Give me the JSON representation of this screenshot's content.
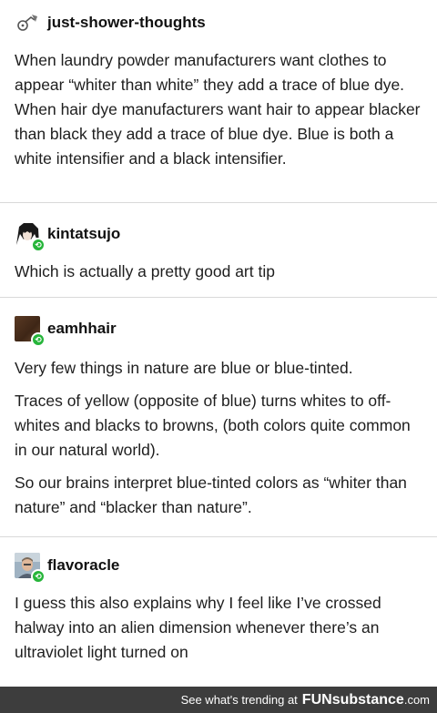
{
  "posts": [
    {
      "username": "just-shower-thoughts",
      "avatar_icon": "gramophone-icon",
      "reblog": false,
      "paragraphs": [
        "When laundry powder manufacturers want clothes to appear “whiter than white” they add a trace of blue dye. When hair dye manufacturers want hair to appear blacker than black they add a trace of blue dye. Blue is both a white intensifier and a black intensifier."
      ]
    },
    {
      "username": "kintatsujo",
      "avatar_icon": "anime-avatar-icon",
      "reblog": true,
      "paragraphs": [
        "Which is actually a pretty good art tip"
      ]
    },
    {
      "username": "eamhhair",
      "avatar_icon": "brown-avatar-icon",
      "reblog": true,
      "paragraphs": [
        "Very few things in nature are blue or blue-tinted.",
        "Traces of yellow (opposite of blue) turns whites to off-whites and blacks to browns, (both colors quite common in our natural world).",
        "So our brains interpret blue-tinted colors as “whiter than nature” and “blacker than nature”."
      ]
    },
    {
      "username": "flavoracle",
      "avatar_icon": "photo-avatar-icon",
      "reblog": true,
      "paragraphs": [
        "I guess this also explains why I feel like I’ve crossed halway into an alien dimension whenever there’s an ultraviolet light turned on"
      ]
    }
  ],
  "footer": {
    "text": "See what's trending at",
    "brand_fun": "FUN",
    "brand_sub": "substance",
    "brand_tld": ".com"
  },
  "colors": {
    "reblog_badge": "#26b53a",
    "footer_bg": "#3d3d3d",
    "divider": "#d9d9d9"
  }
}
